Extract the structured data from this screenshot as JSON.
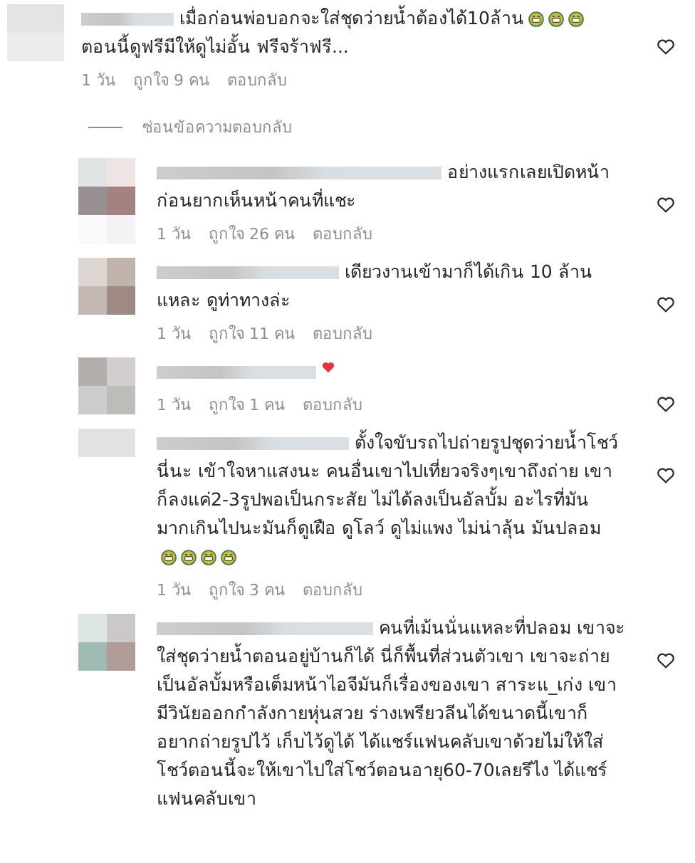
{
  "comment": {
    "lines": [
      {
        "text": "เมื่อก่อนพ่อบอกจะใส่ชุดว่ายน้ำต้องได้10ล้าน",
        "emojis": [
          {
            "kind": "grin"
          },
          {
            "kind": "grin"
          },
          {
            "kind": "grin"
          }
        ]
      },
      {
        "text": "ตอนนี้ดูฟรีมีให้ดูไม่อั้น ฟรีจร้าฟรี..."
      }
    ],
    "meta": [
      "1 วัน",
      "ถูกใจ 9 คน",
      "ตอบกลับ"
    ]
  },
  "hide_replies": "ซ่อนข้อความตอบกลับ",
  "replies": [
    {
      "lines": [
        {
          "text": "อย่างแรกเลยเปิดหน้า"
        },
        {
          "text": "ก่อนยากเห็นหน้าคนที่แชะ"
        }
      ],
      "meta": [
        "1 วัน",
        "ถูกใจ 26 คน",
        "ตอบกลับ"
      ]
    },
    {
      "lines": [
        {
          "text": "เดียวงานเข้ามาก็ได้เกิน 10 ล้าน"
        },
        {
          "text": "แหละ ดูท่าทางล่ะ"
        }
      ],
      "meta": [
        "1 วัน",
        "ถูกใจ 11 คน",
        "ตอบกลับ"
      ]
    },
    {
      "lines": [
        {
          "emojis": [
            {
              "kind": "heart"
            }
          ]
        }
      ],
      "meta": [
        "1 วัน",
        "ถูกใจ 1 คน",
        "ตอบกลับ"
      ]
    },
    {
      "lines": [
        {
          "text": "ตั้งใจขับรถไปถ่ายรูปชุดว่ายน้ำโชว์"
        },
        {
          "text": "นี่นะ เข้าใจหาแสงนะ คนอื่นเขาไปเที่ยวจริงๆเขาถึงถ่าย เขา"
        },
        {
          "text": "ก็ลงแค่2-3รูปพอเป็นกระสัย ไม่ได้ลงเป็นอัลบั้ม อะไรที่มัน"
        },
        {
          "text": "มากเกินไปนะมันก็ดูเฝือ ดูโลว์ ดูไม่แพง ไม่น่าลุ้น มันปลอม"
        },
        {
          "emojis": [
            {
              "kind": "grin"
            },
            {
              "kind": "grin"
            },
            {
              "kind": "grin"
            },
            {
              "kind": "grin"
            }
          ]
        }
      ],
      "meta": [
        "1 วัน",
        "ถูกใจ 3 คน",
        "ตอบกลับ"
      ]
    },
    {
      "lines": [
        {
          "text": "คนที่เม้นนั่นแหละที่ปลอม เขาจะ"
        },
        {
          "text": "ใส่ชุดว่ายน้ำตอนอยู่บ้านก็ได้ นี่ก็พื้นที่ส่วนตัวเขา เขาจะถ่าย"
        },
        {
          "text": "เป็นอัลบั้มหรือเต็มหน้าไอจีมันก็เรื่องของเขา สาระแ_เก่ง เขา"
        },
        {
          "text": "มีวินัยออกกำลังกายหุ่นสวย ร่างเพรียวลีนได้ขนาดนี้เขาก็"
        },
        {
          "text": "อยากถ่ายรูปไว้ เก็บไว้ดูได้ ได้แชร์แฟนคลับเขาด้วยไม่ให้ใส่"
        },
        {
          "text": "โชว์ตอนนี้จะให้เขาไปใส่โชว์ตอนอายุ60-70เลยรึไง ได้แชร์"
        },
        {
          "text": "แฟนคลับเขา"
        }
      ]
    }
  ]
}
